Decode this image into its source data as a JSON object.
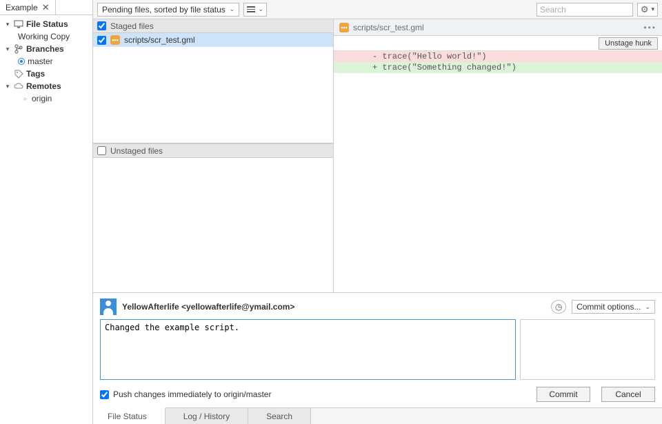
{
  "tab": {
    "title": "Example"
  },
  "sidebar": {
    "file_status": "File Status",
    "working_copy": "Working Copy",
    "branches": "Branches",
    "master": "master",
    "tags": "Tags",
    "remotes": "Remotes",
    "origin": "origin"
  },
  "toolbar": {
    "sort_label": "Pending files, sorted by file status",
    "search_placeholder": "Search"
  },
  "staging": {
    "staged_header": "Staged files",
    "unstaged_header": "Unstaged files",
    "staged_files": [
      {
        "path": "scripts/scr_test.gml"
      }
    ]
  },
  "diff": {
    "file_path": "scripts/scr_test.gml",
    "unstage_hunk": "Unstage hunk",
    "lines": [
      {
        "type": "del",
        "text": "- trace(\"Hello world!\")"
      },
      {
        "type": "add",
        "text": "+ trace(\"Something changed!\")"
      }
    ]
  },
  "commit": {
    "author": "YellowAfterlife <yellowafterlife@ymail.com>",
    "options_label": "Commit options...",
    "message": "Changed the example script.",
    "push_label": "Push changes immediately to origin/master",
    "commit_btn": "Commit",
    "cancel_btn": "Cancel"
  },
  "bottom_tabs": {
    "file_status": "File Status",
    "log_history": "Log / History",
    "search": "Search"
  }
}
